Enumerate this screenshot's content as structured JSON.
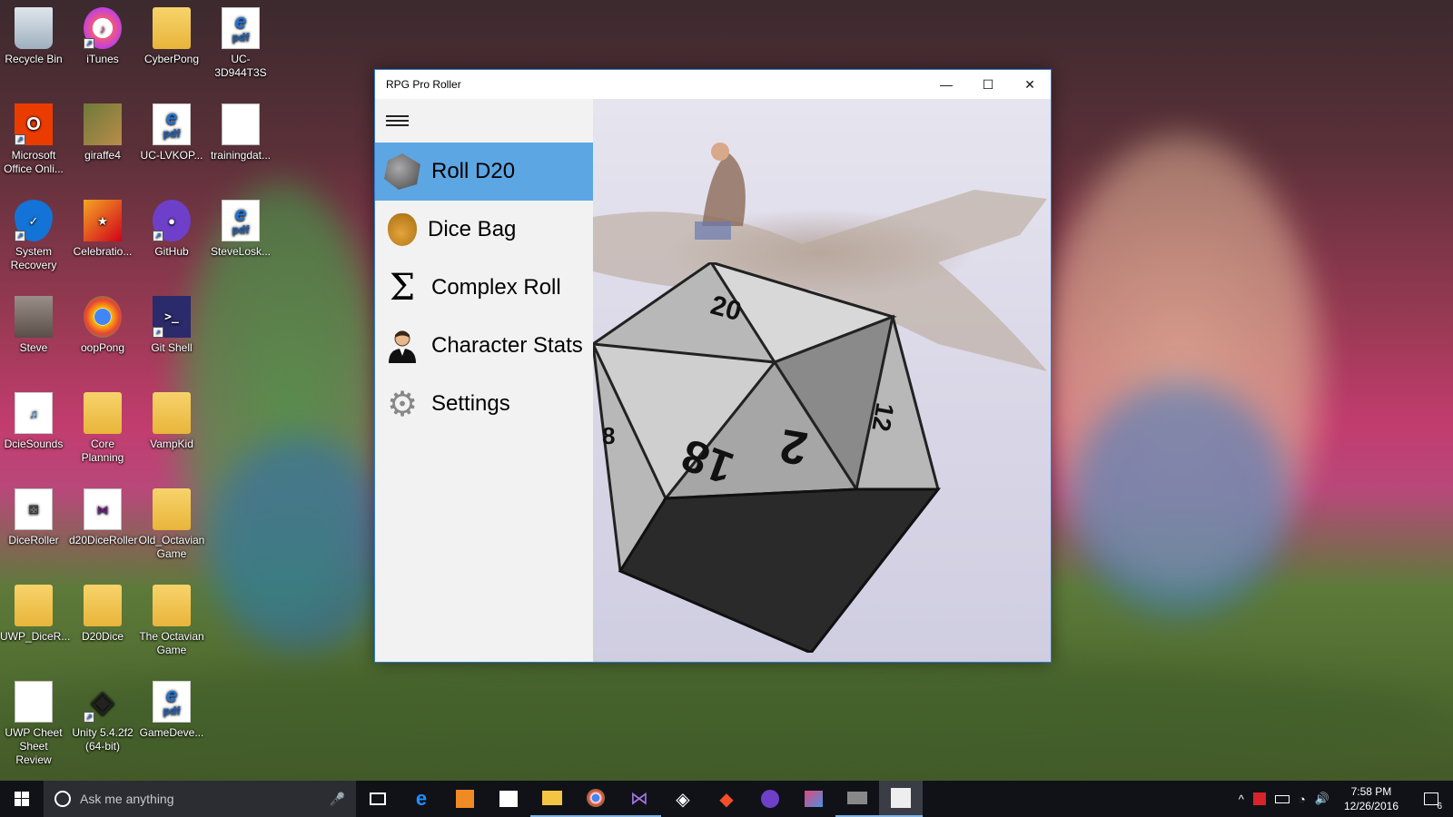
{
  "desktop": {
    "icons": [
      {
        "label": "Recycle Bin",
        "icon": "recycle-bin-icon"
      },
      {
        "label": "iTunes",
        "icon": "itunes-icon"
      },
      {
        "label": "CyberPong",
        "icon": "folder-icon"
      },
      {
        "label": "UC-3D944T3S",
        "icon": "pdf-icon"
      },
      {
        "label": "Microsoft Office Onli...",
        "icon": "office-icon"
      },
      {
        "label": "giraffe4",
        "icon": "image-icon"
      },
      {
        "label": "UC-LVKOP...",
        "icon": "pdf-icon"
      },
      {
        "label": "trainingdat...",
        "icon": "document-icon"
      },
      {
        "label": "System Recovery",
        "icon": "shield-icon"
      },
      {
        "label": "Celebratio...",
        "icon": "image-icon"
      },
      {
        "label": "GitHub",
        "icon": "github-icon"
      },
      {
        "label": "SteveLosk...",
        "icon": "pdf-icon"
      },
      {
        "label": "Steve",
        "icon": "user-photo-icon"
      },
      {
        "label": "oopPong",
        "icon": "chrome-icon"
      },
      {
        "label": "Git Shell",
        "icon": "shell-icon"
      },
      {
        "label": "DcieSounds",
        "icon": "app-icon"
      },
      {
        "label": "Core Planning",
        "icon": "folder-icon"
      },
      {
        "label": "VampKid",
        "icon": "folder-icon"
      },
      {
        "label": "DiceRoller",
        "icon": "dice-icon"
      },
      {
        "label": "d20DiceRoller",
        "icon": "visual-studio-icon"
      },
      {
        "label": "Old_Octavian Game",
        "icon": "folder-icon"
      },
      {
        "label": "UWP_DiceR...",
        "icon": "folder-icon"
      },
      {
        "label": "D20Dice",
        "icon": "folder-icon"
      },
      {
        "label": "The Octavian Game",
        "icon": "folder-icon"
      },
      {
        "label": "UWP Cheet Sheet Review",
        "icon": "document-icon"
      },
      {
        "label": "Unity 5.4.2f2 (64-bit)",
        "icon": "unity-icon"
      },
      {
        "label": "GameDeve...",
        "icon": "pdf-icon"
      }
    ]
  },
  "window": {
    "title": "RPG Pro Roller",
    "minimize_glyph": "—",
    "maximize_glyph": "☐",
    "close_glyph": "✕"
  },
  "nav": {
    "items": [
      {
        "label": "Roll D20",
        "icon": "d20-icon",
        "selected": true
      },
      {
        "label": "Dice Bag",
        "icon": "dice-bag-icon",
        "selected": false
      },
      {
        "label": "Complex Roll",
        "icon": "sigma-icon",
        "selected": false
      },
      {
        "label": "Character Stats",
        "icon": "character-icon",
        "selected": false
      },
      {
        "label": "Settings",
        "icon": "gear-icon",
        "selected": false
      }
    ],
    "sigma_glyph": "Σ",
    "gear_glyph": "⚙"
  },
  "content": {
    "die_faces": [
      "20",
      "2",
      "18",
      "12",
      "8"
    ]
  },
  "taskbar": {
    "search_placeholder": "Ask me anything",
    "time": "7:58 PM",
    "date": "12/26/2016",
    "notification_count": "6",
    "accent": "#2b78d4"
  }
}
